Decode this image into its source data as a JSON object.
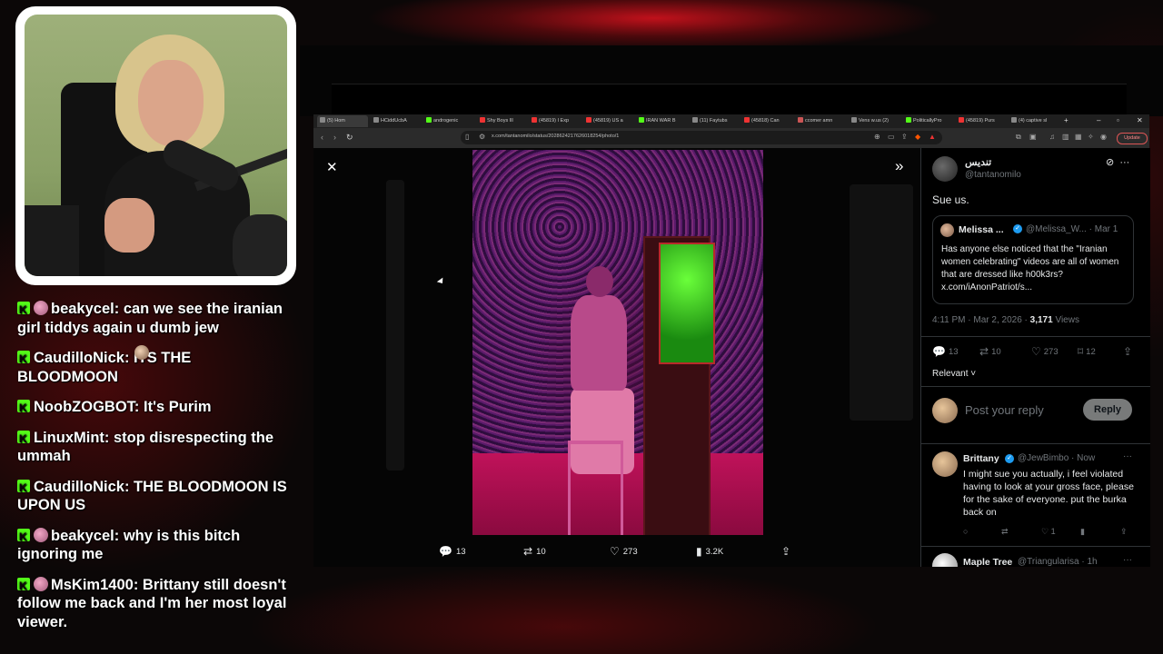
{
  "browser": {
    "tabs": [
      {
        "label": "(5) Hom",
        "color": "#888"
      },
      {
        "label": "HCiddUcbA",
        "color": "#888"
      },
      {
        "label": "androgenic",
        "color": "#53fc18"
      },
      {
        "label": "Shy Boys Ill",
        "color": "#e33"
      },
      {
        "label": "(45819) I Exp",
        "color": "#e33"
      },
      {
        "label": "(45819) US a",
        "color": "#e33"
      },
      {
        "label": "IRAN WAR B",
        "color": "#53fc18"
      },
      {
        "label": "(11) Faytubs",
        "color": "#888"
      },
      {
        "label": "(45818) Can",
        "color": "#e33"
      },
      {
        "label": "ccomer amn",
        "color": "#c55"
      },
      {
        "label": "Vens w.us (2)",
        "color": "#888"
      },
      {
        "label": "PoliticallyPro",
        "color": "#53fc18"
      },
      {
        "label": "(45819) Purs",
        "color": "#e33"
      },
      {
        "label": "(4) captive sl",
        "color": "#888"
      }
    ],
    "url": "x.com/tantanomilo/status/2028624217626018254/photo/1",
    "update_label": "Update"
  },
  "viewer": {
    "close_icon": "close-icon",
    "actions": [
      {
        "icon": "reply-icon",
        "glyph": "💬",
        "count": "13"
      },
      {
        "icon": "retweet-icon",
        "glyph": "⇄",
        "count": "10"
      },
      {
        "icon": "like-icon",
        "glyph": "♡",
        "count": "273"
      },
      {
        "icon": "views-icon",
        "glyph": "▮",
        "count": "3.2K"
      },
      {
        "icon": "share-icon",
        "glyph": "⇪",
        "count": ""
      }
    ]
  },
  "post": {
    "name": "تنديس",
    "handle": "@tantanomilo",
    "text": "Sue us.",
    "quote": {
      "name": "Melissa ...",
      "handle": "@Melissa_W...",
      "date": "· Mar 1",
      "text": "Has anyone else noticed that the \"Iranian women celebrating\" videos are all of women that are dressed like h00k3rs? x.com/iAnonPatriot/s..."
    },
    "time": "4:11 PM · Mar 2, 2026 · ",
    "views_count": "3,171",
    "views_label": " Views",
    "stats": {
      "replies": "13",
      "retweets": "10",
      "likes": "273",
      "bookmarks": "12"
    },
    "sort_label": "Relevant",
    "reply_placeholder": "Post your reply",
    "reply_button": "Reply"
  },
  "comments": [
    {
      "name": "Brittany",
      "handle": "@JewBimbo · Now",
      "text": "I might sue you actually, i feel violated having to look at your gross face, please for the sake of everyone. put the burka back on",
      "likes": "1"
    },
    {
      "name": "Maple Tree",
      "handle": "@Triangularisa · 1h"
    }
  ],
  "chat": [
    {
      "emote": "pink",
      "user": "beakycel",
      "text": "can we see the iranian girl tiddys again u dumb jew"
    },
    {
      "emote": "",
      "user": "CaudilloNick",
      "text": "ITS THE BLOODMOON"
    },
    {
      "emote": "",
      "user": "NoobZOGBOT",
      "text": "It's Purim"
    },
    {
      "emote": "",
      "user": "LinuxMint",
      "text": "stop disrespecting the ummah",
      "inline_emote": "face"
    },
    {
      "emote": "",
      "user": "CaudilloNick",
      "text": "THE BLOODMOON IS UPON US"
    },
    {
      "emote": "pink",
      "user": "beakycel",
      "text": "why is this bitch ignoring me"
    },
    {
      "emote": "pink",
      "user": "MsKim1400",
      "text": "Brittany still doesn't follow me back and I'm her most loyal viewer."
    }
  ],
  "colors": {
    "accent": "#1d9bf0",
    "kick": "#53fc18"
  }
}
